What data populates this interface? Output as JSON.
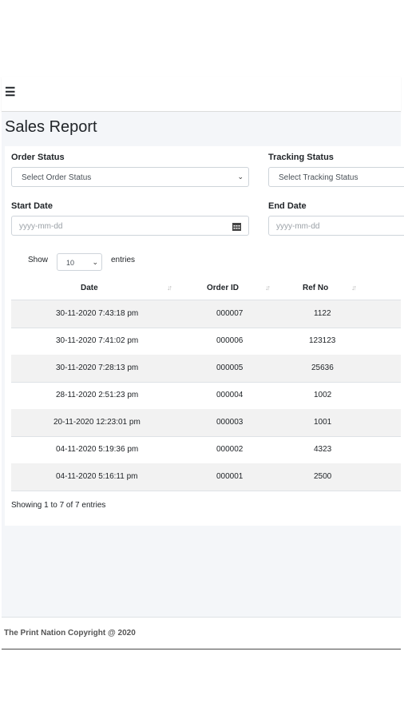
{
  "topbar": {
    "menu_icon": "bars-icon"
  },
  "page": {
    "title": "Sales Report"
  },
  "filters": {
    "order_status_label": "Order Status",
    "order_status_value": "Select Order Status",
    "tracking_status_label": "Tracking Status",
    "tracking_status_value": "Select Tracking Status",
    "start_date_label": "Start Date",
    "start_date_placeholder": "yyyy-mm-dd",
    "end_date_label": "End Date",
    "end_date_placeholder": "yyyy-mm-dd"
  },
  "table": {
    "show_label": "Show",
    "page_length": "10",
    "entries_label": "entries",
    "columns": [
      "Date",
      "Order ID",
      "Ref No"
    ],
    "rows": [
      {
        "date": "30-11-2020 7:43:18 pm",
        "order_id": "000007",
        "ref_no": "1122"
      },
      {
        "date": "30-11-2020 7:41:02 pm",
        "order_id": "000006",
        "ref_no": "123123"
      },
      {
        "date": "30-11-2020 7:28:13 pm",
        "order_id": "000005",
        "ref_no": "25636"
      },
      {
        "date": "28-11-2020 2:51:23 pm",
        "order_id": "000004",
        "ref_no": "1002"
      },
      {
        "date": "20-11-2020 12:23:01 pm",
        "order_id": "000003",
        "ref_no": "1001"
      },
      {
        "date": "04-11-2020 5:19:36 pm",
        "order_id": "000002",
        "ref_no": "4323"
      },
      {
        "date": "04-11-2020 5:16:11 pm",
        "order_id": "000001",
        "ref_no": "2500"
      }
    ],
    "info": "Showing 1 to 7 of 7 entries"
  },
  "footer": {
    "text": "The Print Nation Copyright @ 2020"
  },
  "colors": {
    "content_bg": "#f4f6f9",
    "striped_row": "#f2f2f2",
    "border": "#ced4da"
  }
}
